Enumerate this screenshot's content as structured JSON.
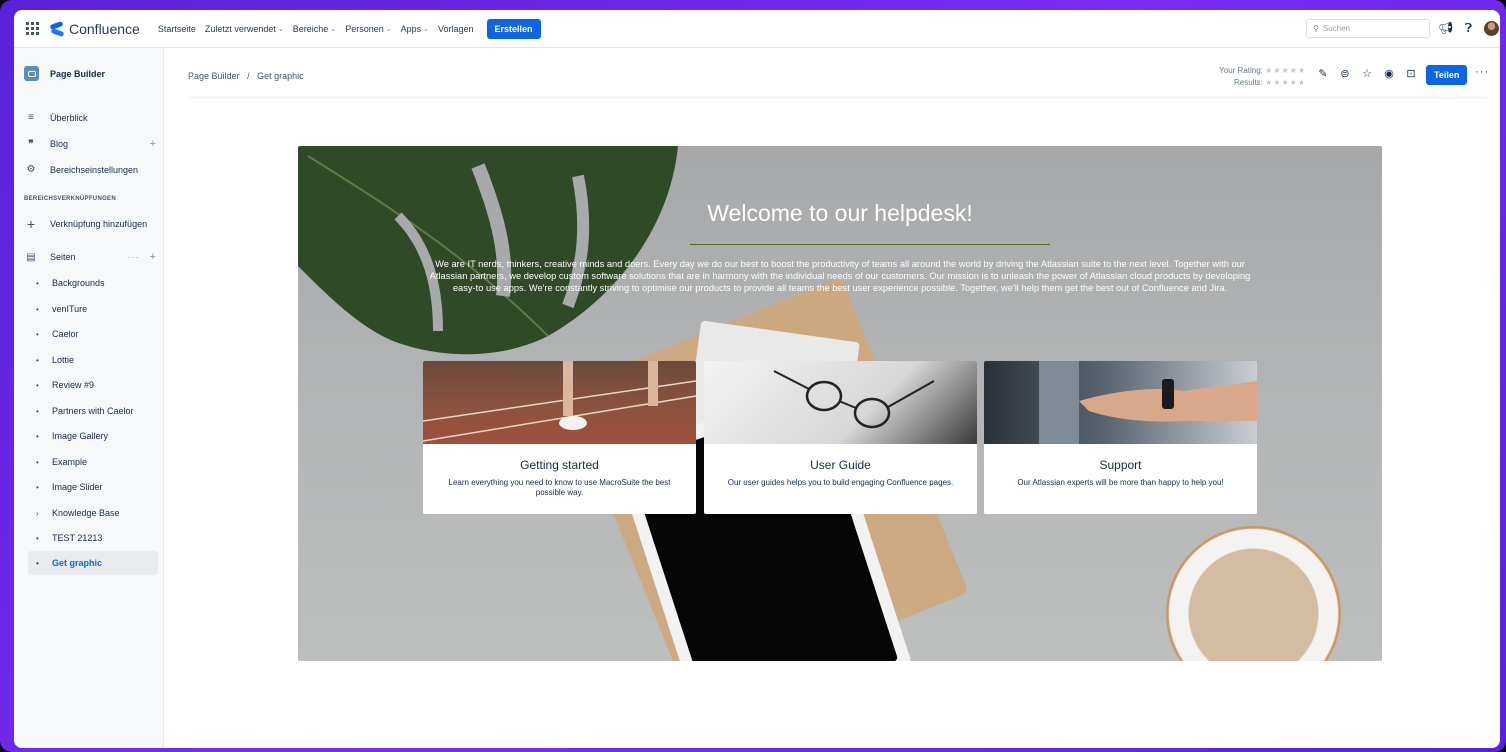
{
  "topnav": {
    "app_name": "Confluence",
    "items": [
      {
        "label": "Startseite",
        "has_caret": false
      },
      {
        "label": "Zuletzt verwendet",
        "has_caret": true
      },
      {
        "label": "Bereiche",
        "has_caret": true
      },
      {
        "label": "Personen",
        "has_caret": true
      },
      {
        "label": "Apps",
        "has_caret": true
      },
      {
        "label": "Vorlagen",
        "has_caret": false
      }
    ],
    "create_label": "Erstellen",
    "search_placeholder": "Suchen",
    "icons": [
      "notification-icon",
      "help-icon",
      "avatar"
    ]
  },
  "sidebar": {
    "space_name": "Page Builder",
    "items": [
      {
        "label": "Überblick",
        "icon": "overview-icon"
      },
      {
        "label": "Blog",
        "icon": "quote-icon"
      },
      {
        "label": "Bereichseinstellungen",
        "icon": "gear-icon"
      }
    ],
    "section_label": "BEREICHSVERKNÜPFUNGEN",
    "add_link_label": "Verknüpfung hinzufügen",
    "pages_label": "Seiten",
    "pages": [
      {
        "label": "Backgrounds",
        "marker": "•"
      },
      {
        "label": "venITure",
        "marker": "•"
      },
      {
        "label": "Caelor",
        "marker": "•"
      },
      {
        "label": "Lottie",
        "marker": "•"
      },
      {
        "label": "Review #9",
        "marker": "•"
      },
      {
        "label": "Partners with Caelor",
        "marker": "•"
      },
      {
        "label": "Image Gallery",
        "marker": "•"
      },
      {
        "label": "Example",
        "marker": "•"
      },
      {
        "label": "Image Slider",
        "marker": "•"
      },
      {
        "label": "Knowledge Base",
        "marker": "›"
      },
      {
        "label": "TEST 21213",
        "marker": "•"
      },
      {
        "label": "Get graphic",
        "marker": "•",
        "active": true
      }
    ]
  },
  "breadcrumb": {
    "items": [
      "Page Builder",
      "Get graphic"
    ],
    "separator": "/"
  },
  "rating": {
    "your_rating_label": "Your Rating:",
    "results_label": "Results:",
    "stars": "★★★★★"
  },
  "page_actions": {
    "icons": [
      "edit-icon",
      "comment-icon",
      "star-icon",
      "watch-icon",
      "restriction-icon"
    ],
    "share_label": "Teilen",
    "more_label": "···"
  },
  "hero": {
    "title": "Welcome to our helpdesk!",
    "text": "We are IT nerds, thinkers, creative minds and doers. Every day we do our best to boost the productivity of teams all around the world by driving the Atlassian suite to the next level. Together with our Atlassian partners, we develop custom software solutions that are in harmony with the individual needs of our customers. Our mission is to unleash the power of Atlassian cloud products by developing easy-to use apps. We're constantly striving to optimise our products to provide all teams the best user experience possible. Together, we'll help them get the best out of Confluence and Jira.",
    "cards": [
      {
        "title": "Getting started",
        "desc": "Learn everything you need to know to use MacroSuite the best possible way."
      },
      {
        "title": "User Guide",
        "desc": "Our user guides helps you to build engaging Confluence pages."
      },
      {
        "title": "Support",
        "desc": "Our Atlassian experts will be more than happy to help you!"
      }
    ]
  },
  "colors": {
    "primary": "#0c66e4",
    "frame": "#6a28e8",
    "hero_overlay": "#a6a8aa"
  }
}
